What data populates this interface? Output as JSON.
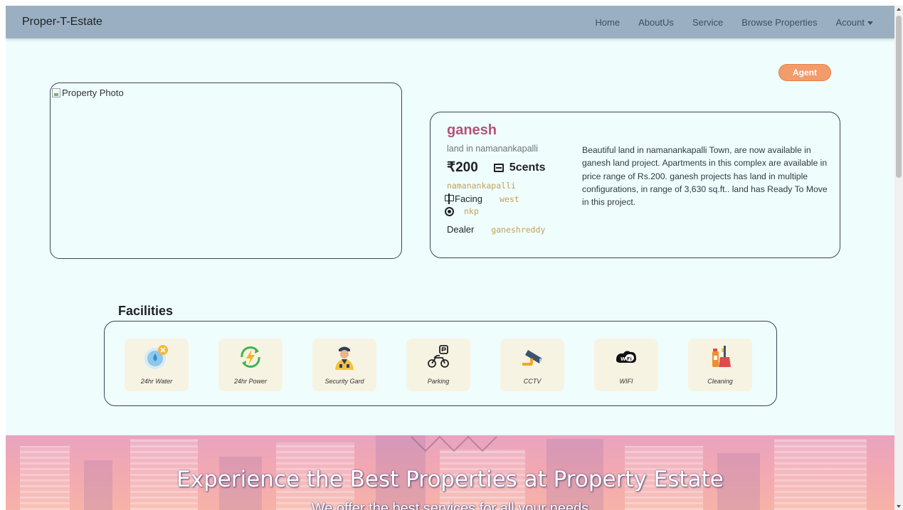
{
  "navbar": {
    "brand": "Proper-T-Estate",
    "links": [
      "Home",
      "AboutUs",
      "Service",
      "Browse Properties"
    ],
    "account_label": "Acount"
  },
  "agent_button": "Agent",
  "photo": {
    "alt_text": "Property Photo"
  },
  "property": {
    "name": "ganesh",
    "subtitle": "land in namanankapalli",
    "price": "₹200",
    "area": "5cents",
    "locality": "namanankapalli",
    "facing_label": "Facing",
    "facing_value": "west",
    "place": "nkp",
    "dealer_label": "Dealer",
    "dealer_value": "ganeshreddy",
    "description": "Beautiful land in namanankapalli Town, are now available in ganesh land project. Apartments in this complex are available in price range of Rs.200. ganesh projects has land in multiple configurations, in range of 3,630 sq.ft.. land has Ready To Move in this project."
  },
  "facilities": {
    "title": "Facilities",
    "items": [
      {
        "label": "24hr Water",
        "icon": "water-icon"
      },
      {
        "label": "24hr Power",
        "icon": "power-icon"
      },
      {
        "label": "Security Gard",
        "icon": "security-guard-icon"
      },
      {
        "label": "Parking",
        "icon": "parking-icon"
      },
      {
        "label": "CCTV",
        "icon": "cctv-icon"
      },
      {
        "label": "WIFI",
        "icon": "wifi-icon"
      },
      {
        "label": "Cleaning",
        "icon": "cleaning-icon"
      }
    ]
  },
  "hero": {
    "title": "Experience the Best Properties at Property Estate",
    "subtitle": "We offer the best services for all your needs"
  },
  "colors": {
    "navbar_bg": "#9ab0c2",
    "page_bg": "#effdfd",
    "agent_badge": "#f39c6b",
    "property_name": "#b45279",
    "mono_value": "#c2a15a",
    "facility_tile": "#f7f3e3"
  }
}
